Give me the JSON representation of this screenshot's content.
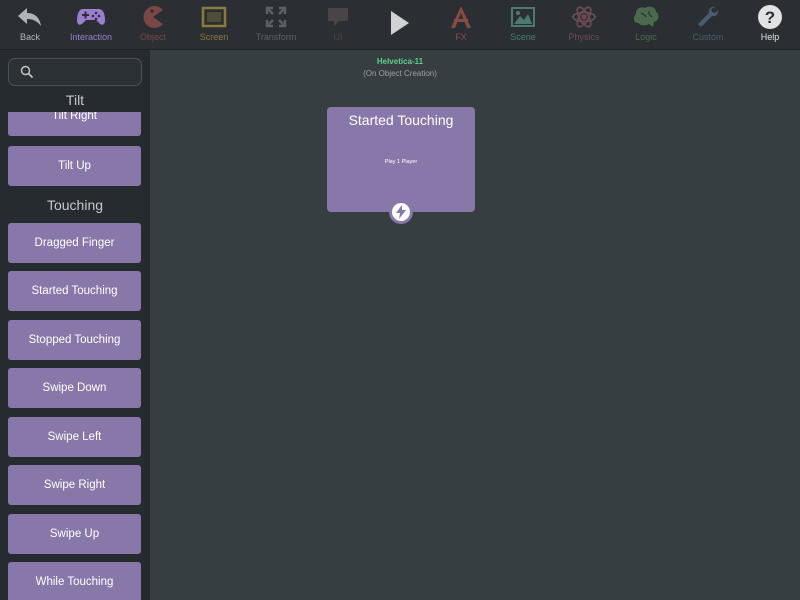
{
  "toolbar": {
    "back": {
      "label": "Back",
      "icon": "back-arrow-icon",
      "color": "#b0b4b8"
    },
    "interaction": {
      "label": "Interaction",
      "icon": "gamepad-icon",
      "color": "#9a7fd0"
    },
    "object": {
      "label": "Object",
      "icon": "pacman-icon",
      "color": "#7a4646"
    },
    "screen": {
      "label": "Screen",
      "icon": "screen-icon",
      "color": "#8a7a3e"
    },
    "transform": {
      "label": "Transform",
      "icon": "expand-arrows-icon",
      "color": "#5a6064"
    },
    "ui": {
      "label": "UI",
      "icon": "speech-bubble-icon",
      "color": "#4a4446"
    },
    "play": {
      "icon": "play-icon",
      "color": "#d0d2d4"
    },
    "fx": {
      "label": "FX",
      "icon": "fx-icon",
      "color": "#8a4a44"
    },
    "scene": {
      "label": "Scene",
      "icon": "landscape-icon",
      "color": "#4a7a72"
    },
    "physics": {
      "label": "Physics",
      "icon": "atom-icon",
      "color": "#6a4a52"
    },
    "logic": {
      "label": "Logic",
      "icon": "brain-icon",
      "color": "#4a6a4e"
    },
    "custom": {
      "label": "Custom",
      "icon": "wrench-icon",
      "color": "#4a5a70"
    },
    "help": {
      "label": "Help",
      "icon": "help-icon",
      "color": "#e0e2e4"
    }
  },
  "sidebar": {
    "search_placeholder": "",
    "sections": [
      {
        "title": "Tilt",
        "items": [
          "Tilt Right",
          "Tilt Up"
        ]
      },
      {
        "title": "Touching",
        "items": [
          "Dragged Finger",
          "Started Touching",
          "Stopped Touching",
          "Swipe Down",
          "Swipe Left",
          "Swipe Right",
          "Swipe Up",
          "While Touching"
        ]
      }
    ]
  },
  "canvas": {
    "object_name": "Helvetica-11",
    "context": "(On Object Creation)",
    "behavior": {
      "title": "Started Touching",
      "action": "Play 1 Player",
      "badge_icon": "lightning-bolt-icon"
    }
  },
  "colors": {
    "accent": "#8878aa",
    "background": "#373e42",
    "toolbar": "#2b2f33",
    "sidebar": "#262b2f",
    "object_name": "#5fd08a"
  }
}
